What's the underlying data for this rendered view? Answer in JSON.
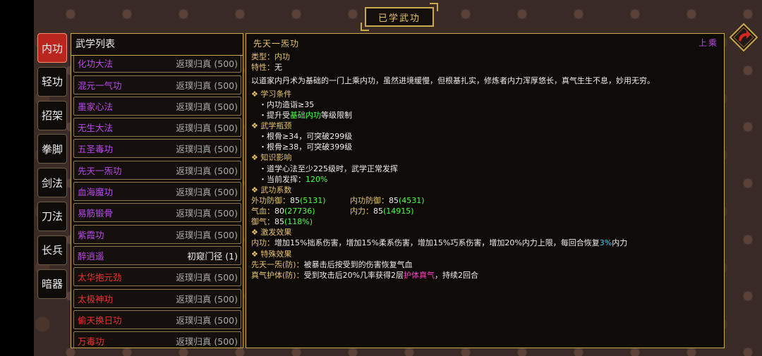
{
  "window": {
    "title": "已学武功",
    "grade": "上乘"
  },
  "categories": [
    {
      "label": "内功",
      "active": true
    },
    {
      "label": "轻功"
    },
    {
      "label": "招架"
    },
    {
      "label": "拳脚"
    },
    {
      "label": "剑法"
    },
    {
      "label": "刀法"
    },
    {
      "label": "长兵"
    },
    {
      "label": "暗器"
    }
  ],
  "list": {
    "header": "武学列表",
    "items": [
      {
        "name": "化功大法",
        "level": "返璞归真 (500)",
        "color": "purple"
      },
      {
        "name": "混元一气功",
        "level": "返璞归真 (500)",
        "color": "purple"
      },
      {
        "name": "墨家心法",
        "level": "返璞归真 (500)",
        "color": "purple"
      },
      {
        "name": "无生大法",
        "level": "返璞归真 (500)",
        "color": "purple"
      },
      {
        "name": "五圣毒功",
        "level": "返璞归真 (500)",
        "color": "purple"
      },
      {
        "name": "先天一炁功",
        "level": "返璞归真 (500)",
        "color": "purple"
      },
      {
        "name": "血海魔功",
        "level": "返璞归真 (500)",
        "color": "purple"
      },
      {
        "name": "易筋锻骨",
        "level": "返璞归真 (500)",
        "color": "purple"
      },
      {
        "name": "紫霞功",
        "level": "返璞归真 (500)",
        "color": "purple"
      },
      {
        "name": "醉逍遥",
        "level": "初窥门径 (1)",
        "color": "purple"
      },
      {
        "name": "太华抱元劲",
        "level": "返璞归真 (500)",
        "color": "red"
      },
      {
        "name": "太极神功",
        "level": "返璞归真 (500)",
        "color": "red"
      },
      {
        "name": "偷天换日功",
        "level": "返璞归真 (500)",
        "color": "red"
      },
      {
        "name": "万毒功",
        "level": "返璞归真 (500)",
        "color": "red"
      }
    ]
  },
  "detail": {
    "name": "先天一炁功",
    "type_label": "类型：",
    "type_value": "内功",
    "trait_label": "特性：",
    "trait_value": "无",
    "desc": "以道家内丹术为基础的一门上乘内功，虽然进境缓慢，但根基扎实，修炼者内力浑厚悠长，真气生生不息，妙用无穷。",
    "learn": {
      "title": "学习条件",
      "req1": "・内功造诣≥35",
      "req2_pre": "・提升受",
      "req2_hl": "基础内功",
      "req2_post": "等级限制"
    },
    "bottleneck": {
      "title": "武学瓶颈",
      "b1": "・根骨≥34，可突破299级",
      "b2": "・根骨≥38，可突破399级"
    },
    "knowledge": {
      "title": "知识影响",
      "k1": "・道学心法至少225级时，武学正常发挥",
      "k2_pre": "・当前发挥：",
      "k2_val": "120%"
    },
    "coeff": {
      "title": "武功系数",
      "wg_label": "外功防御：",
      "wg_val": "85",
      "wg_extra": "(5131)",
      "ng_label": "内功防御：",
      "ng_val": "85",
      "ng_extra": "(4531)",
      "qi_label": "气血：",
      "qi_val": "80",
      "qi_extra": "(27736)",
      "nl_label": "内力：",
      "nl_val": "85",
      "nl_extra": "(14915)",
      "yq_label": "御气：",
      "yq_val": "85",
      "yq_extra": "(118%)"
    },
    "trigger": {
      "title": "激发效果",
      "line_label": "内功：",
      "line_pre": "增加15%拙系伤害，增加15%柔系伤害，增加15%巧系伤害，增加20%内力上限，每回合恢复",
      "line_hl": "3%",
      "line_post": "内力"
    },
    "special": {
      "title": "特殊效果",
      "s1_label": "先天一炁(防)：",
      "s1_text": "被暴击后按受到的伤害恢复气血",
      "s2_label": "真气护体(防)：",
      "s2_pre": "受到攻击后20%几率获得2层",
      "s2_hl": "护体真气",
      "s2_post": "，持续2回合"
    }
  },
  "colors": {
    "gold": "#e6c36a",
    "purple": "#b84ae8",
    "red": "#f03030",
    "green": "#4cff4c",
    "pink": "#ff3cc8",
    "cyan": "#3ccfff"
  }
}
